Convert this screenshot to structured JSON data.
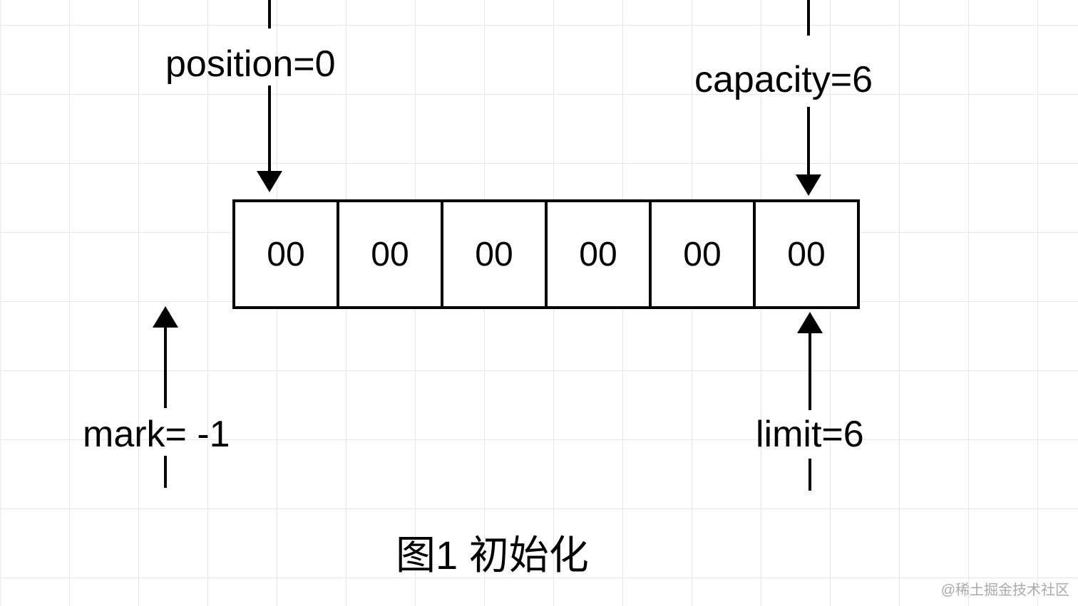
{
  "labels": {
    "position": "position=0",
    "capacity": "capacity=6",
    "mark": "mark= -1",
    "limit": "limit=6"
  },
  "cells": [
    "00",
    "00",
    "00",
    "00",
    "00",
    "00"
  ],
  "caption": "图1 初始化",
  "watermark": "@稀土掘金技术社区",
  "chart_data": {
    "type": "table",
    "title": "图1 初始化",
    "description": "Buffer initialization state diagram",
    "buffer_values": [
      "00",
      "00",
      "00",
      "00",
      "00",
      "00"
    ],
    "pointers": {
      "mark": -1,
      "position": 0,
      "limit": 6,
      "capacity": 6
    },
    "buffer_length": 6
  }
}
